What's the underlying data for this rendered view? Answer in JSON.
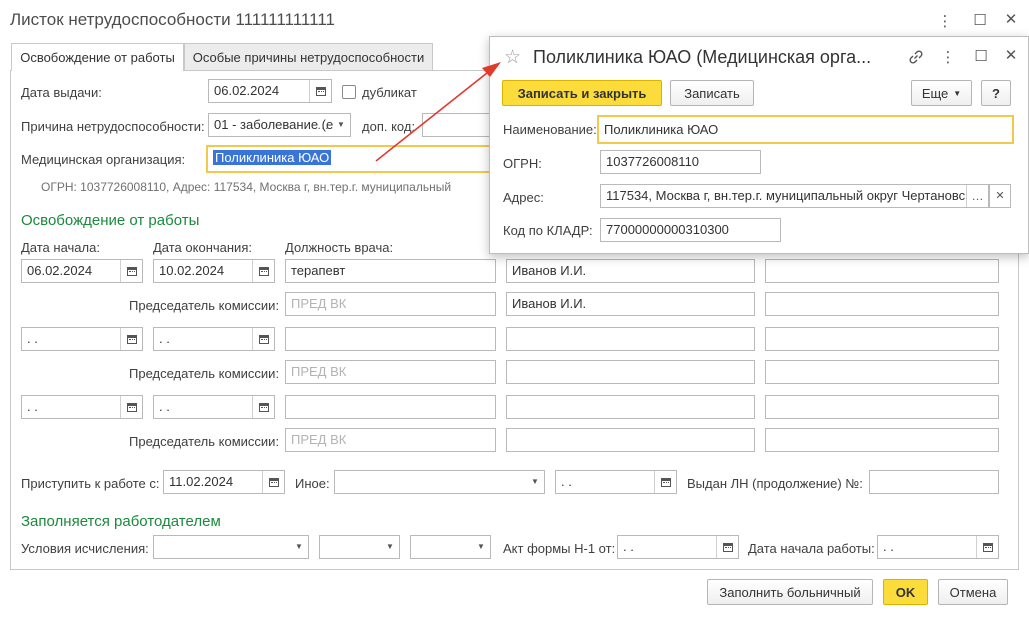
{
  "main": {
    "title": "Листок нетрудоспособности 111111111111",
    "tabs": [
      {
        "label": "Освобождение от работы"
      },
      {
        "label": "Особые причины нетрудоспособности"
      }
    ],
    "issue_date_label": "Дата выдачи:",
    "issue_date": "06.02.2024",
    "duplicate_label": "дубликат",
    "reason_label": "Причина нетрудоспособности:",
    "reason_value": "01 - заболевание (е",
    "extra_code_label": "доп. код:",
    "med_org_label": "Медицинская организация:",
    "med_org_value": "Поликлиника ЮАО",
    "ogrn_address": "ОГРН: 1037726008110, Адрес: 117534, Москва г, вн.тер.г. муниципальный",
    "section_release": "Освобождение от работы",
    "start_date_label": "Дата начала:",
    "end_date_label": "Дата окончания:",
    "doctor_position_label": "Должность врача:",
    "rows": [
      {
        "start": "06.02.2024",
        "end": "10.02.2024",
        "position": "терапевт",
        "doctor": "Иванов И.И.",
        "extra": "",
        "chair_label": "Председатель комиссии:",
        "chair_placeholder": "ПРЕД ВК",
        "chair_name": "Иванов И.И."
      },
      {
        "start": " .  .",
        "end": " .  .",
        "position": "",
        "doctor": "",
        "extra": "",
        "chair_label": "Председатель комиссии:",
        "chair_placeholder": "ПРЕД ВК",
        "chair_name": ""
      },
      {
        "start": " .  .",
        "end": " .  .",
        "position": "",
        "doctor": "",
        "extra": "",
        "chair_label": "Председатель комиссии:",
        "chair_placeholder": "ПРЕД ВК",
        "chair_name": ""
      }
    ],
    "return_label": "Приступить к работе с:",
    "return_date": "11.02.2024",
    "other_label": "Иное:",
    "other_date": " .  .",
    "issued_cont_label": "Выдан ЛН (продолжение) №:",
    "section_employer": "Заполняется работодателем",
    "calc_conditions_label": "Условия исчисления:",
    "act_label": "Акт формы Н-1 от:",
    "act_date": " .  .",
    "work_start_label": "Дата начала работы:",
    "work_start_date": " .  .",
    "fill_button": "Заполнить больничный",
    "ok_button": "OK",
    "cancel_button": "Отмена"
  },
  "popup": {
    "title": "Поликлиника ЮАО (Медицинская орга...",
    "save_close_button": "Записать и закрыть",
    "save_button": "Записать",
    "more_button": "Еще",
    "help_button": "?",
    "name_label": "Наименование:",
    "name_value": "Поликлиника ЮАО",
    "ogrn_label": "ОГРН:",
    "ogrn_value": "1037726008110",
    "address_label": "Адрес:",
    "address_value": "117534, Москва г, вн.тер.г. муниципальный округ Чертановс",
    "kladr_label": "Код по КЛАДР:",
    "kladr_value": "77000000000310300"
  },
  "colors": {
    "accent_yellow": "#fbdc3b",
    "section_green": "#1b8a3d",
    "focus_border": "#f2c94c",
    "selection_blue": "#3875d7",
    "arrow_red": "#e03a2e"
  }
}
